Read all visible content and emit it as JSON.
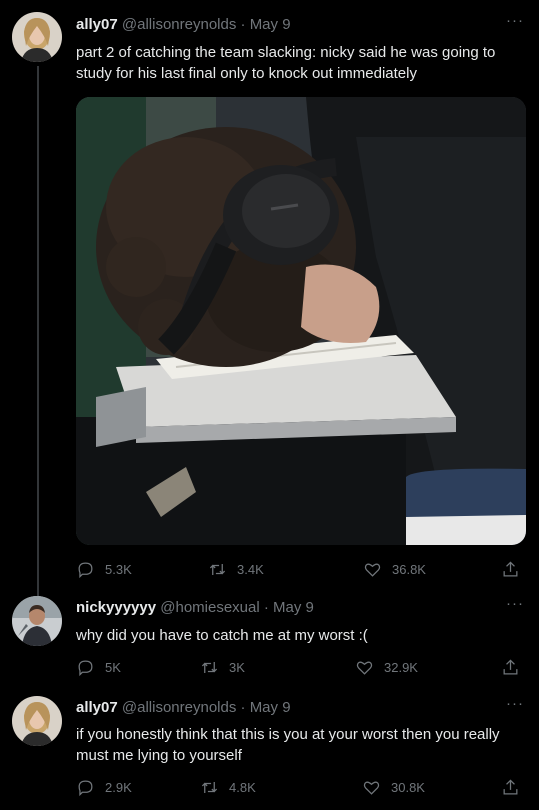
{
  "tweets": [
    {
      "name": "ally07",
      "handle": "@allisonreynolds",
      "separator": "·",
      "date": "May 9",
      "text": "part 2 of catching the team slacking: nicky said he was going to study for his last final only to knock out immediately",
      "has_media": true,
      "stats": {
        "replies": "5.3K",
        "retweets": "3.4K",
        "likes": "36.8K"
      }
    },
    {
      "name": "nickyyyyyy",
      "handle": "@homiesexual",
      "separator": "·",
      "date": "May 9",
      "text": "why did you have to catch me at my worst :(",
      "stats": {
        "replies": "5K",
        "retweets": "3K",
        "likes": "32.9K"
      }
    },
    {
      "name": "ally07",
      "handle": "@allisonreynolds",
      "separator": "·",
      "date": "May 9",
      "text": "if you honestly think that this is you at your worst then you really must me lying to yourself",
      "stats": {
        "replies": "2.9K",
        "retweets": "4.8K",
        "likes": "30.8K"
      }
    }
  ],
  "more_label": "···",
  "icons": {
    "reply": "reply-icon",
    "retweet": "retweet-icon",
    "like": "heart-icon",
    "share": "share-icon"
  },
  "colors": {
    "background": "#000000",
    "text": "#e7e9ea",
    "muted": "#71767b",
    "thread_line": "#333639"
  }
}
